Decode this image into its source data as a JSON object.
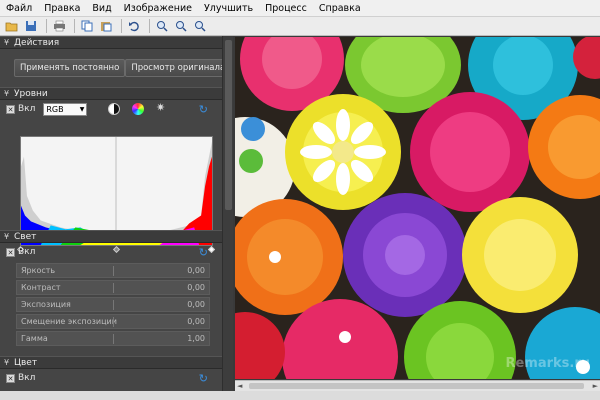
{
  "menu": {
    "items": [
      "Файл",
      "Правка",
      "Вид",
      "Изображение",
      "Улучшить",
      "Процесс",
      "Справка"
    ]
  },
  "toolbar": {
    "icons": [
      "open-icon",
      "save-icon",
      "print-icon",
      "copy-icon",
      "paste-icon",
      "undo-icon",
      "zoom-in-icon",
      "zoom-out-icon",
      "zoom-fit-icon"
    ]
  },
  "actions": {
    "title": "Действия",
    "apply_label": "Применять постоянно",
    "preview_label": "Просмотр оригинала"
  },
  "levels": {
    "title": "Уровни",
    "enable_label": "Вкл",
    "channel": "RGB"
  },
  "light": {
    "title": "Свет",
    "enable_label": "Вкл",
    "params": [
      {
        "label": "Яркость",
        "value": "0,00"
      },
      {
        "label": "Контраст",
        "value": "0,00"
      },
      {
        "label": "Экспозиция",
        "value": "0,00"
      },
      {
        "label": "Смещение экспозиции",
        "value": "0,00"
      },
      {
        "label": "Гамма",
        "value": "1,00"
      }
    ]
  },
  "color": {
    "title": "Цвет",
    "enable_label": "Вкл"
  },
  "watermark": "Remarks.ru"
}
